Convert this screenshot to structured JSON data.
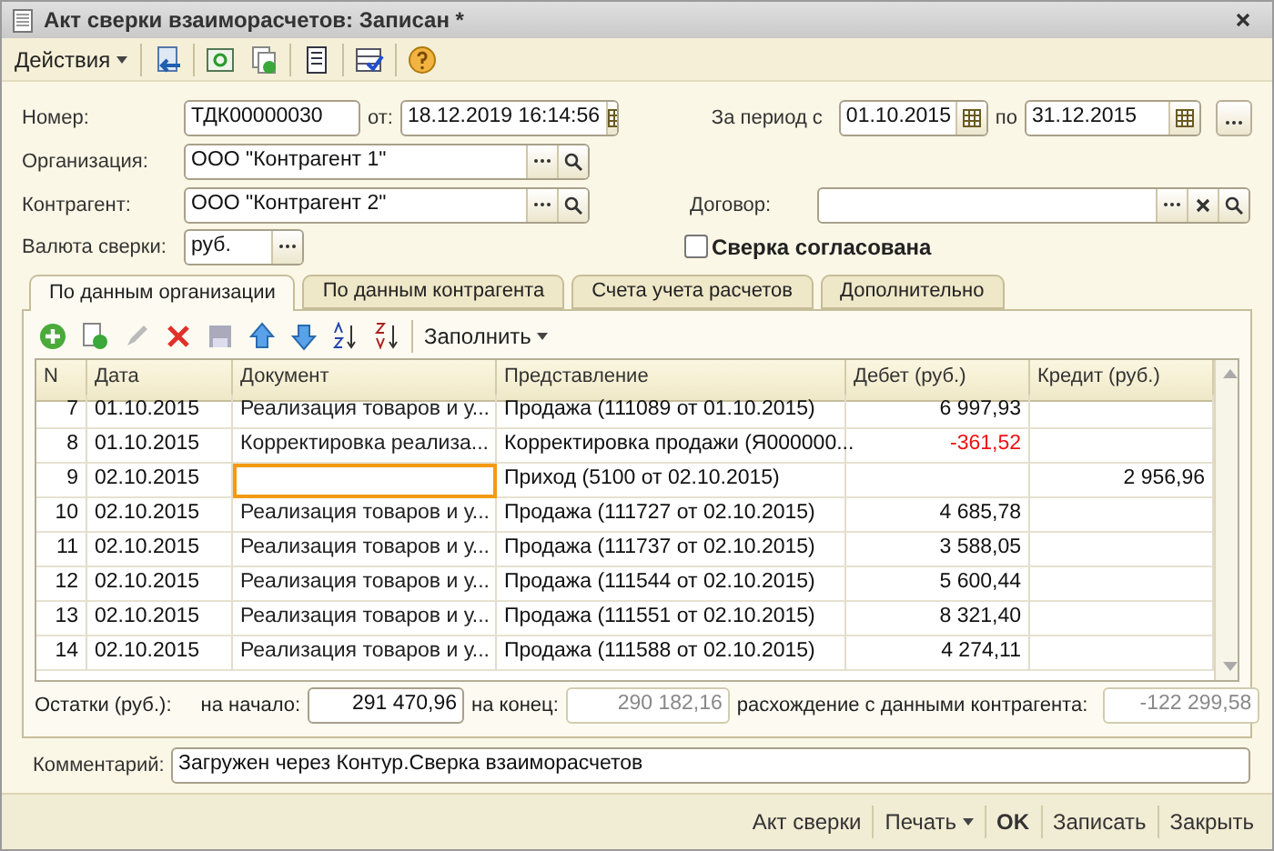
{
  "window": {
    "title": "Акт сверки взаиморасчетов: Записан *"
  },
  "toolbar": {
    "actions_menu": "Действия"
  },
  "form": {
    "number_label": "Номер:",
    "number": "ТДК00000030",
    "date_label": "от:",
    "date": "18.12.2019 16:14:56",
    "period_label": "За период с",
    "period_from": "01.10.2015",
    "period_to_label": "по",
    "period_to": "31.12.2015",
    "organization_label": "Организация:",
    "organization": "ООО \"Контрагент 1\"",
    "counterparty_label": "Контрагент:",
    "counterparty": "ООО \"Контрагент 2\"",
    "contract_label": "Договор:",
    "currency_label": "Валюта сверки:",
    "currency": "руб.",
    "agreed": {
      "label": "Сверка согласована",
      "checked": false
    }
  },
  "tabs": [
    {
      "label": "По данным организации",
      "selected": true
    },
    {
      "label": "По данным контрагента",
      "selected": false
    },
    {
      "label": "Счета учета расчетов",
      "selected": false
    },
    {
      "label": "Дополнительно",
      "selected": false
    }
  ],
  "tab_toolbar": {
    "fill_menu": "Заполнить"
  },
  "table": {
    "columns": [
      "N",
      "Дата",
      "Документ",
      "Представление",
      "Дебет (руб.)",
      "Кредит (руб.)"
    ],
    "rows": [
      {
        "n": "7",
        "date": "01.10.2015",
        "doc": "Реализация товаров и у...",
        "repr": "Продажа (111089 от 01.10.2015)",
        "debit": "6 997,93",
        "negative": false,
        "focused": false
      },
      {
        "n": "8",
        "date": "01.10.2015",
        "doc": "Корректировка реализа...",
        "repr": "Корректировка продажи (Я000000...",
        "debit": "-361,52",
        "negative": true,
        "focused": false
      },
      {
        "n": "9",
        "date": "02.10.2015",
        "repr": "Приход (5100 от 02.10.2015)",
        "credit": "2 956,96",
        "focused": true
      },
      {
        "n": "10",
        "date": "02.10.2015",
        "doc": "Реализация товаров и у...",
        "repr": "Продажа (111727 от 02.10.2015)",
        "debit": "4 685,78",
        "negative": false,
        "focused": false
      },
      {
        "n": "11",
        "date": "02.10.2015",
        "doc": "Реализация товаров и у...",
        "repr": "Продажа (111737 от 02.10.2015)",
        "debit": "3 588,05",
        "negative": false,
        "focused": false
      },
      {
        "n": "12",
        "date": "02.10.2015",
        "doc": "Реализация товаров и у...",
        "repr": "Продажа (111544 от 02.10.2015)",
        "debit": "5 600,44",
        "negative": false,
        "focused": false
      },
      {
        "n": "13",
        "date": "02.10.2015",
        "doc": "Реализация товаров и у...",
        "repr": "Продажа (111551 от 02.10.2015)",
        "debit": "8 321,40",
        "negative": false,
        "focused": false
      },
      {
        "n": "14",
        "date": "02.10.2015",
        "doc": "Реализация товаров и у...",
        "repr": "Продажа (111588 от 02.10.2015)",
        "debit": "4 274,11",
        "negative": false,
        "focused": false
      }
    ]
  },
  "totals": {
    "label": "Остатки (руб.):",
    "start_label": "на начало:",
    "start": "291 470,96",
    "end_label": "на конец:",
    "end": "290 182,16",
    "diff_label": "расхождение с данными контрагента:",
    "diff": "-122 299,58"
  },
  "comment": {
    "label": "Комментарий:",
    "value": "Загружен через Контур.Сверка взаиморасчетов"
  },
  "footer_buttons": [
    {
      "label": "Акт сверки",
      "kind": "plain"
    },
    {
      "label": "Печать",
      "kind": "menu"
    },
    {
      "label": "OK",
      "kind": "default"
    },
    {
      "label": "Записать",
      "kind": "plain"
    },
    {
      "label": "Закрыть",
      "kind": "plain"
    }
  ]
}
